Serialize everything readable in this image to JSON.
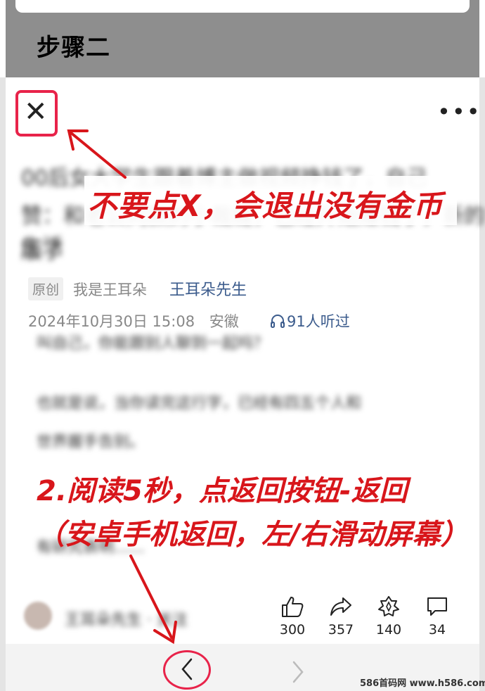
{
  "header": {
    "step_title": "步骤二"
  },
  "toolbar": {
    "close_glyph": "✕",
    "more_glyph": "•••"
  },
  "article": {
    "blurred_title_lines": [
      "00后女大学生跟着博主做视频挣钱了，自己",
      "赞：和老公同款的小裁缝，已经开始赚钱了，新的生活",
      "版了"
    ],
    "tag": "原创",
    "author": "我是王耳朵",
    "account": "王耳朵先生",
    "date": "2024年10月30日 15:08",
    "location": "安徽",
    "listen_count": "91人听过",
    "blurred_body": [
      "叫自己，你能跟别人聊到一起吗？",
      "也就是说，当你读完这行字，已经有四五个人和",
      "世界握手告别。",
      "有研究表明……"
    ]
  },
  "callouts": {
    "close_warning": "不要点X，会退出没有金币",
    "read_line1": "2.阅读5秒，点返回按钮-返回",
    "read_line2": "（安卓手机返回，左/右滑动屏幕）"
  },
  "action_bar": {
    "blurred_name": "王耳朵先生 · 关注",
    "actions": [
      {
        "icon": "thumbs-up-icon",
        "count": "300"
      },
      {
        "icon": "share-icon",
        "count": "357"
      },
      {
        "icon": "star-icon",
        "count": "140"
      },
      {
        "icon": "comment-icon",
        "count": "34"
      }
    ]
  },
  "watermark": "586首码网 www.h586.com",
  "colors": {
    "annotation_red": "#d8161b",
    "highlight_border": "#e8234a",
    "link_blue": "#3b5b8c"
  }
}
